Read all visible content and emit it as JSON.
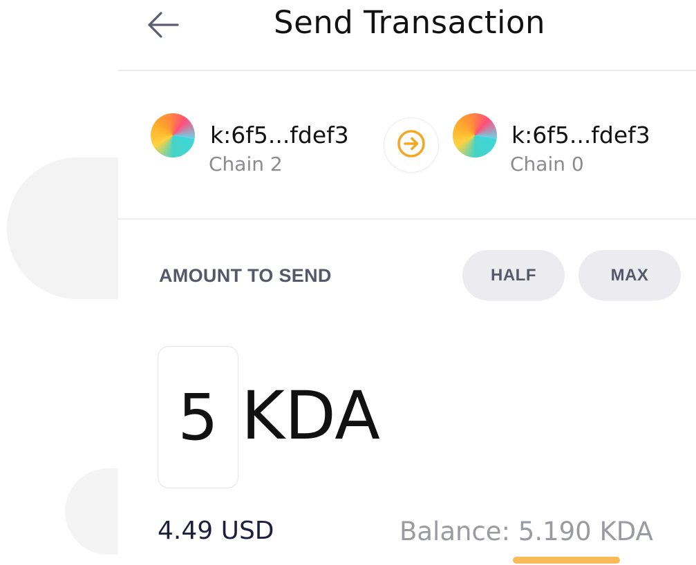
{
  "header": {
    "title": "Send Transaction",
    "back_icon": "arrow-left-icon"
  },
  "sender": {
    "address": "k:6f5...fdef3",
    "chain": "Chain 2"
  },
  "direction_icon": "arrow-right-circle-icon",
  "receiver": {
    "address": "k:6f5...fdef3",
    "chain": "Chain 0"
  },
  "amount": {
    "label": "AMOUNT TO SEND",
    "half_label": "HALF",
    "max_label": "MAX",
    "value": "5",
    "unit": "KDA",
    "usd_value": "4.49 USD",
    "balance": "Balance: 5.190 KDA"
  },
  "colors": {
    "accent": "#F5A623",
    "muted_text": "#8a8a92",
    "label_text": "#565869",
    "pill_bg": "#ececf0"
  }
}
